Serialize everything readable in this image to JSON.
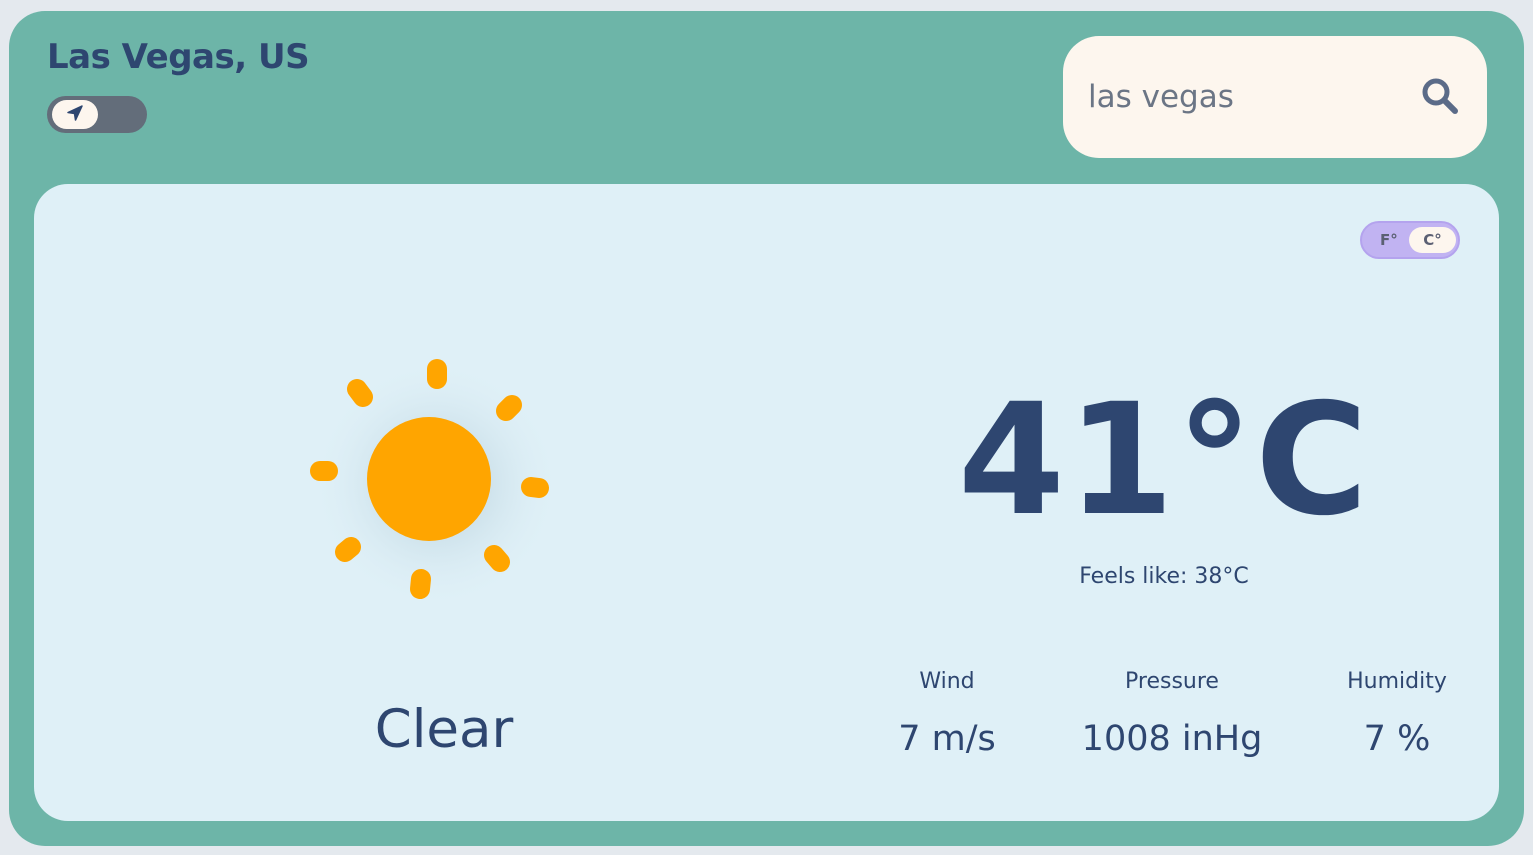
{
  "header": {
    "city": "Las Vegas, US"
  },
  "search": {
    "value": "las vegas",
    "placeholder": ""
  },
  "icons": {
    "location": "location-arrow-icon",
    "search": "search-icon",
    "weather": "sun-icon"
  },
  "unit_toggle": {
    "fahrenheit_label": "F°",
    "celsius_label": "C°",
    "selected": "C°"
  },
  "weather": {
    "condition": "Clear",
    "temperature": "41°C",
    "feels_like_label": "Feels like:",
    "feels_like_value": "38°C"
  },
  "stats": [
    {
      "label": "Wind",
      "value": "7 m/s"
    },
    {
      "label": "Pressure",
      "value": "1008 inHg"
    },
    {
      "label": "Humidity",
      "value": "7 %"
    }
  ],
  "colors": {
    "frame": "#6db5a8",
    "card": "#dff0f7",
    "text": "#2e4670",
    "sun": "#ffa500",
    "search_bg": "#fdf6ee",
    "unit_toggle": "#c1b3f2",
    "location_toggle": "#636d7a"
  }
}
